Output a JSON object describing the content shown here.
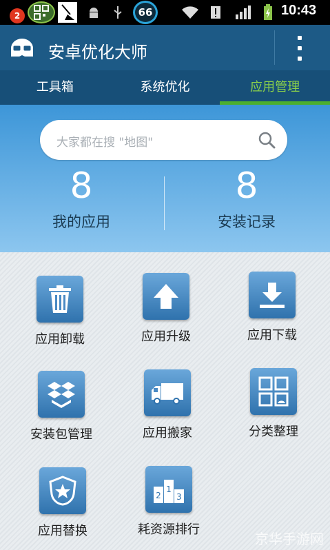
{
  "status_bar": {
    "notification_count": "2",
    "cpu_badge": "66",
    "time": "10:43",
    "icons": [
      "qr-app-icon",
      "broom-icon",
      "android-debug-icon",
      "usb-icon",
      "wifi-icon",
      "warning-icon",
      "signal-icon",
      "battery-icon"
    ]
  },
  "app_bar": {
    "title": "安卓优化大师",
    "logo_icon": "android-glasses-logo",
    "menu_icon": "overflow-menu-icon"
  },
  "tabs": [
    {
      "label": "工具箱",
      "active": false
    },
    {
      "label": "系统优化",
      "active": false
    },
    {
      "label": "应用管理",
      "active": true
    }
  ],
  "search": {
    "placeholder": "大家都在搜 \"地图\""
  },
  "stats": {
    "my_apps_count": "8",
    "my_apps_label": "我的应用",
    "install_records_count": "8",
    "install_records_label": "安装记录"
  },
  "tools": [
    {
      "label": "应用卸载",
      "icon": "trash-icon"
    },
    {
      "label": "应用升级",
      "icon": "arrow-up-icon"
    },
    {
      "label": "应用下载",
      "icon": "download-icon"
    },
    {
      "label": "安装包管理",
      "icon": "package-box-icon"
    },
    {
      "label": "应用搬家",
      "icon": "moving-truck-icon"
    },
    {
      "label": "分类整理",
      "icon": "category-grid-icon"
    },
    {
      "label": "应用替换",
      "icon": "replace-star-shield-icon"
    },
    {
      "label": "耗资源排行",
      "icon": "podium-ranking-icon"
    }
  ],
  "watermark": "京华手游网",
  "colors": {
    "app_bar": "#1d5a86",
    "tab_bar": "#174f78",
    "active_tab": "#8bd04a",
    "tile": "#3f82bd"
  }
}
